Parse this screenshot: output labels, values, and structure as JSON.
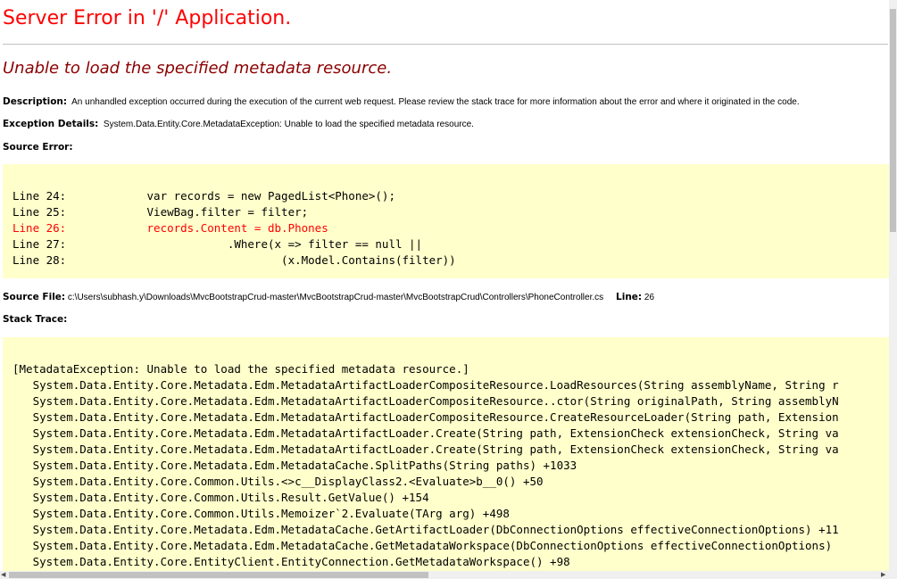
{
  "title": "Server Error in '/' Application.",
  "subtitle": "Unable to load the specified metadata resource.",
  "description": {
    "label": "Description:",
    "text": "An unhandled exception occurred during the execution of the current web request. Please review the stack trace for more information about the error and where it originated in the code."
  },
  "exception_details": {
    "label": "Exception Details:",
    "text": "System.Data.Entity.Core.MetadataException: Unable to load the specified metadata resource."
  },
  "source_error": {
    "label": "Source Error:",
    "lines": [
      {
        "num": "Line 24:",
        "code": "            var records = new PagedList<Phone>();"
      },
      {
        "num": "Line 25:",
        "code": "            ViewBag.filter = filter;"
      },
      {
        "num": "Line 26:",
        "code": "            records.Content = db.Phones"
      },
      {
        "num": "Line 27:",
        "code": "                        .Where(x => filter == null ||"
      },
      {
        "num": "Line 28:",
        "code": "                                (x.Model.Contains(filter))"
      }
    ]
  },
  "source_file": {
    "label": "Source File:",
    "path": "c:\\Users\\subhash.y\\Downloads\\MvcBootstrapCrud-master\\MvcBootstrapCrud-master\\MvcBootstrapCrud\\Controllers\\PhoneController.cs",
    "line_label": "Line:",
    "line_value": "26"
  },
  "stack_trace": {
    "label": "Stack Trace:",
    "lines": [
      "[MetadataException: Unable to load the specified metadata resource.]",
      "   System.Data.Entity.Core.Metadata.Edm.MetadataArtifactLoaderCompositeResource.LoadResources(String assemblyName, String r",
      "   System.Data.Entity.Core.Metadata.Edm.MetadataArtifactLoaderCompositeResource..ctor(String originalPath, String assemblyN",
      "   System.Data.Entity.Core.Metadata.Edm.MetadataArtifactLoaderCompositeResource.CreateResourceLoader(String path, Extension",
      "   System.Data.Entity.Core.Metadata.Edm.MetadataArtifactLoader.Create(String path, ExtensionCheck extensionCheck, String va",
      "   System.Data.Entity.Core.Metadata.Edm.MetadataArtifactLoader.Create(String path, ExtensionCheck extensionCheck, String va",
      "   System.Data.Entity.Core.Metadata.Edm.MetadataCache.SplitPaths(String paths) +1033",
      "   System.Data.Entity.Core.Common.Utils.<>c__DisplayClass2.<Evaluate>b__0() +50",
      "   System.Data.Entity.Core.Common.Utils.Result.GetValue() +154",
      "   System.Data.Entity.Core.Common.Utils.Memoizer`2.Evaluate(TArg arg) +498",
      "   System.Data.Entity.Core.Metadata.Edm.MetadataCache.GetArtifactLoader(DbConnectionOptions effectiveConnectionOptions) +11",
      "   System.Data.Entity.Core.Metadata.Edm.MetadataCache.GetMetadataWorkspace(DbConnectionOptions effectiveConnectionOptions)",
      "   System.Data.Entity.Core.EntityClient.EntityConnection.GetMetadataWorkspace() +98"
    ]
  },
  "colors": {
    "title": "#ff0000",
    "subtitle": "#8b0000",
    "code_background": "#ffffcc",
    "error_line": "#ff0000"
  }
}
